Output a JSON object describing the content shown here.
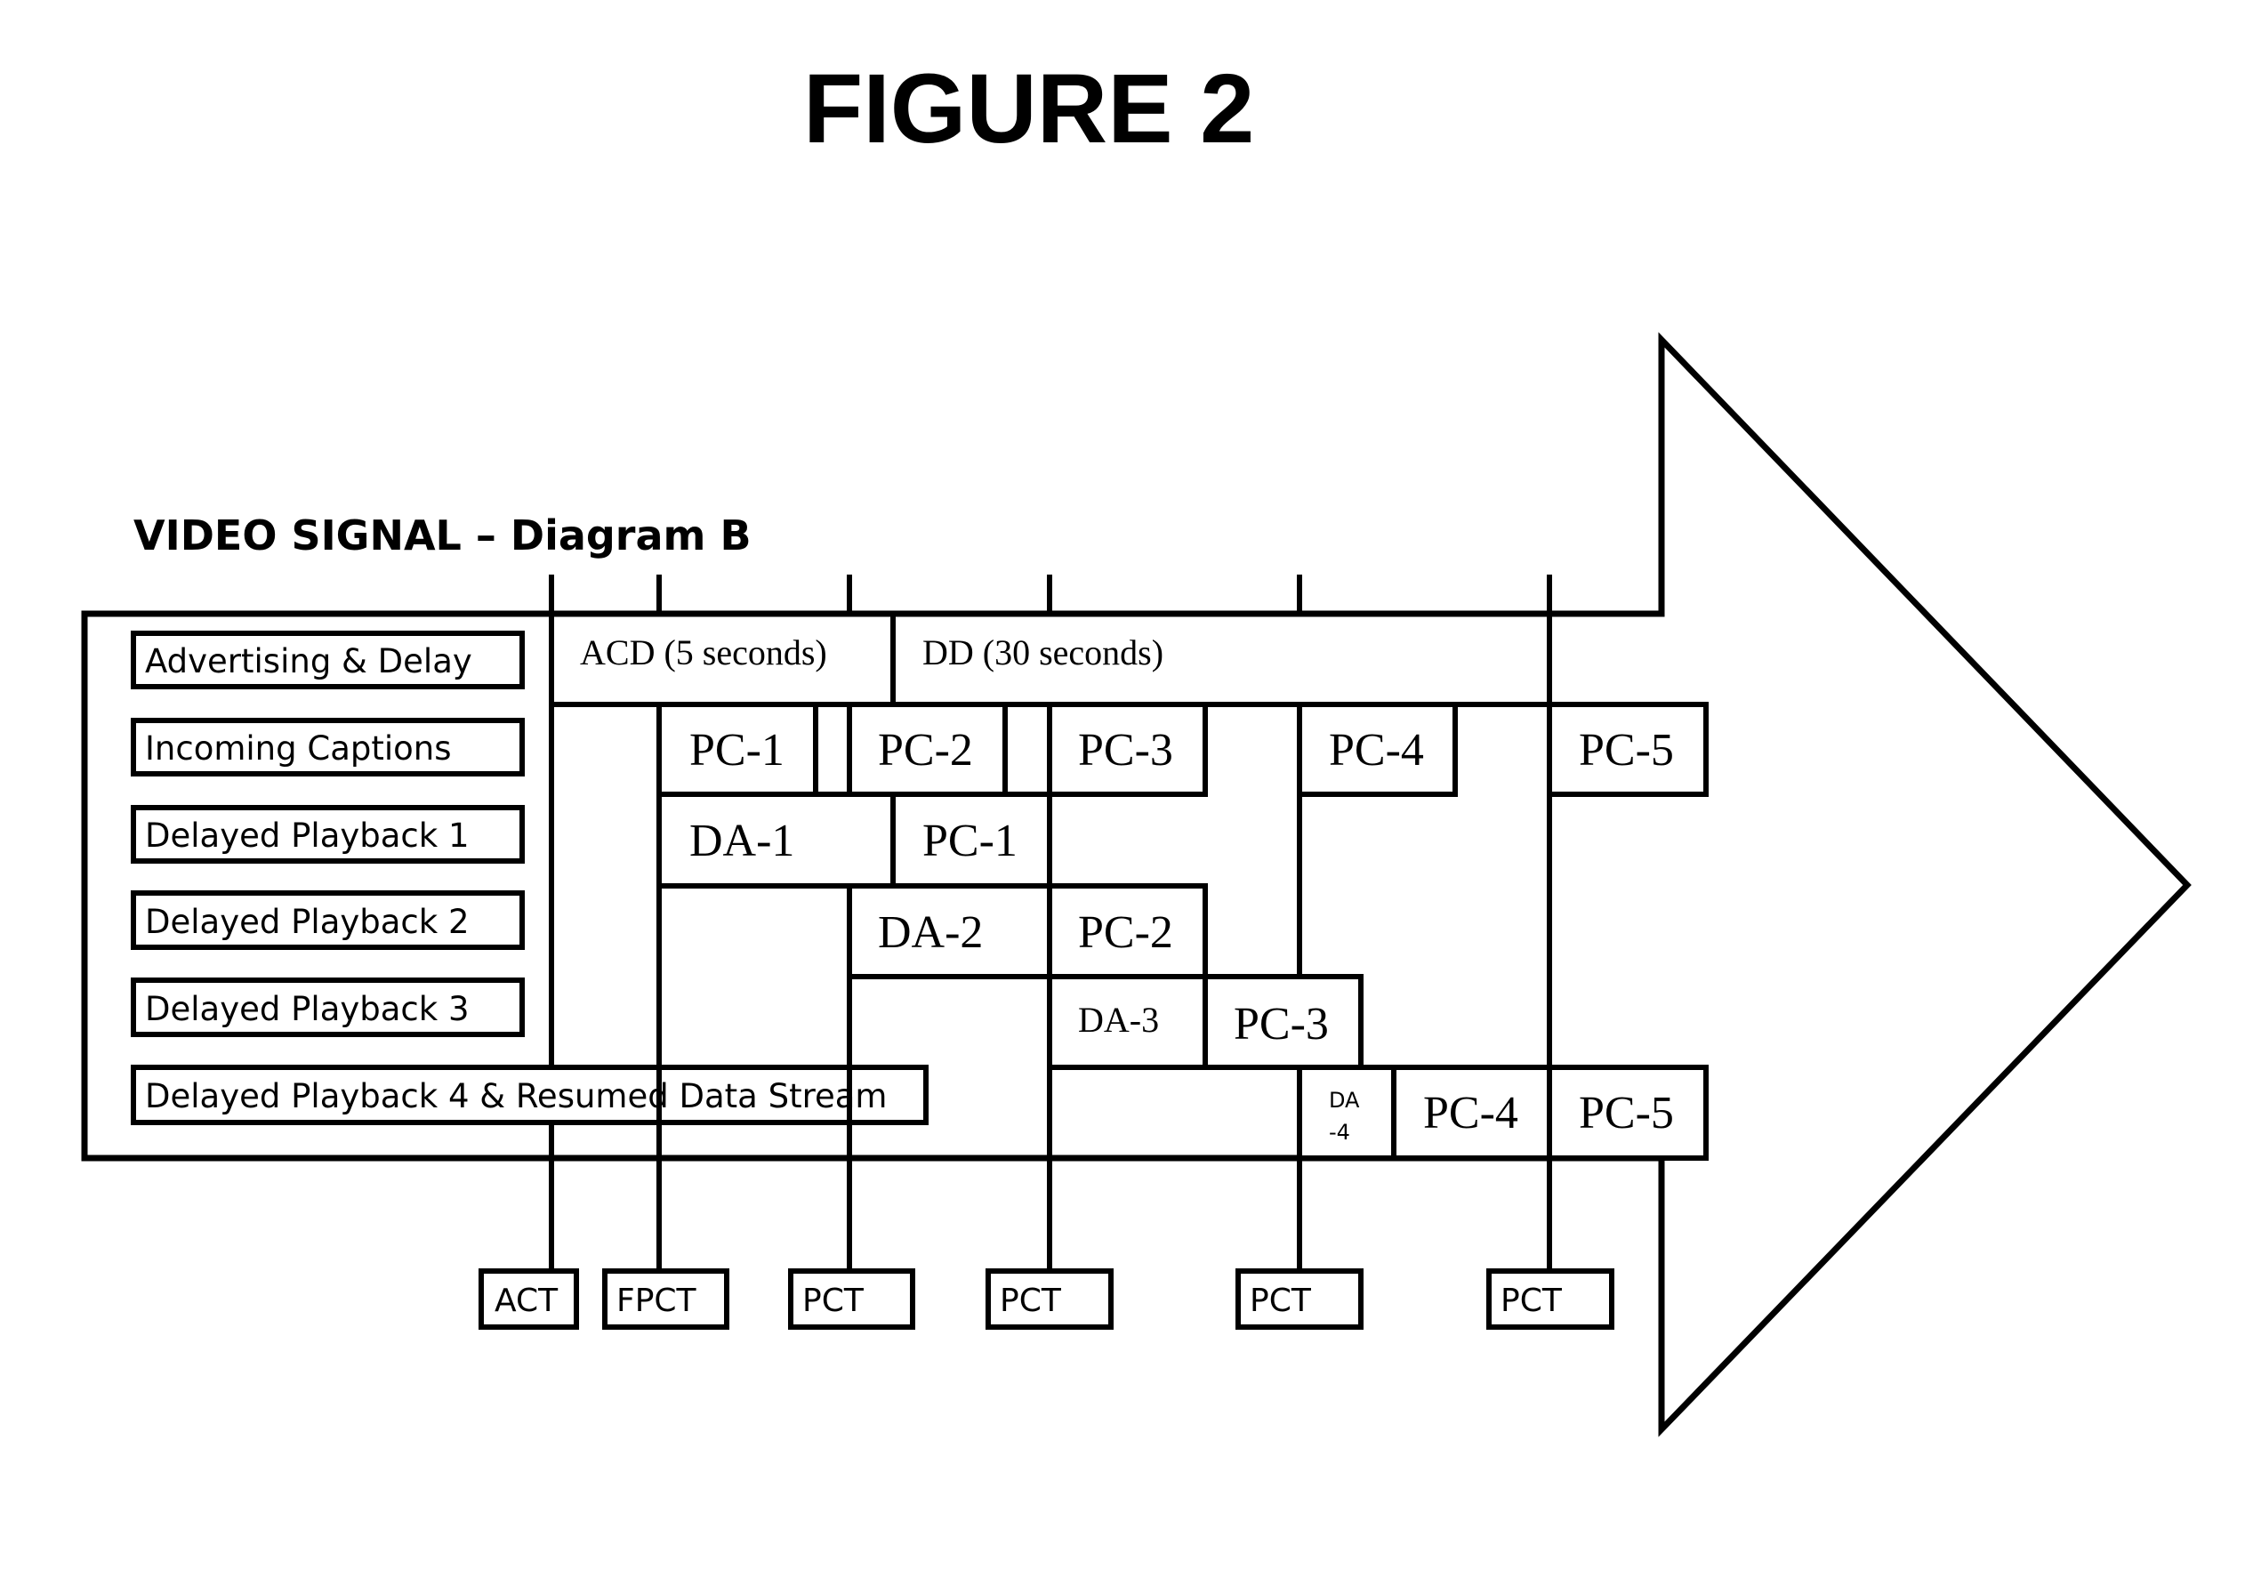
{
  "figure_title": "FIGURE 2",
  "diagram_title": "VIDEO SIGNAL – Diagram B",
  "row_labels": [
    "Advertising & Delay",
    "Incoming Captions",
    "Delayed Playback 1",
    "Delayed Playback 2",
    "Delayed Playback 3",
    "Delayed Playback 4 & Resumed Data Stream"
  ],
  "timeline": {
    "advertising_delay": [
      {
        "label": "ACD (5 seconds)"
      },
      {
        "label": "DD (30 seconds)"
      }
    ],
    "incoming_captions": [
      "PC-1",
      "PC-2",
      "PC-3",
      "PC-4",
      "PC-5"
    ],
    "delayed_playback_1": [
      "DA-1",
      "PC-1"
    ],
    "delayed_playback_2": [
      "DA-2",
      "PC-2"
    ],
    "delayed_playback_3": [
      "DA-3",
      "PC-3"
    ],
    "delayed_playback_4": {
      "da_line1": "DA",
      "da_line2": "-4",
      "captions": [
        "PC-4",
        "PC-5"
      ]
    }
  },
  "markers": [
    "ACT",
    "FPCT",
    "PCT",
    "PCT",
    "PCT",
    "PCT"
  ]
}
